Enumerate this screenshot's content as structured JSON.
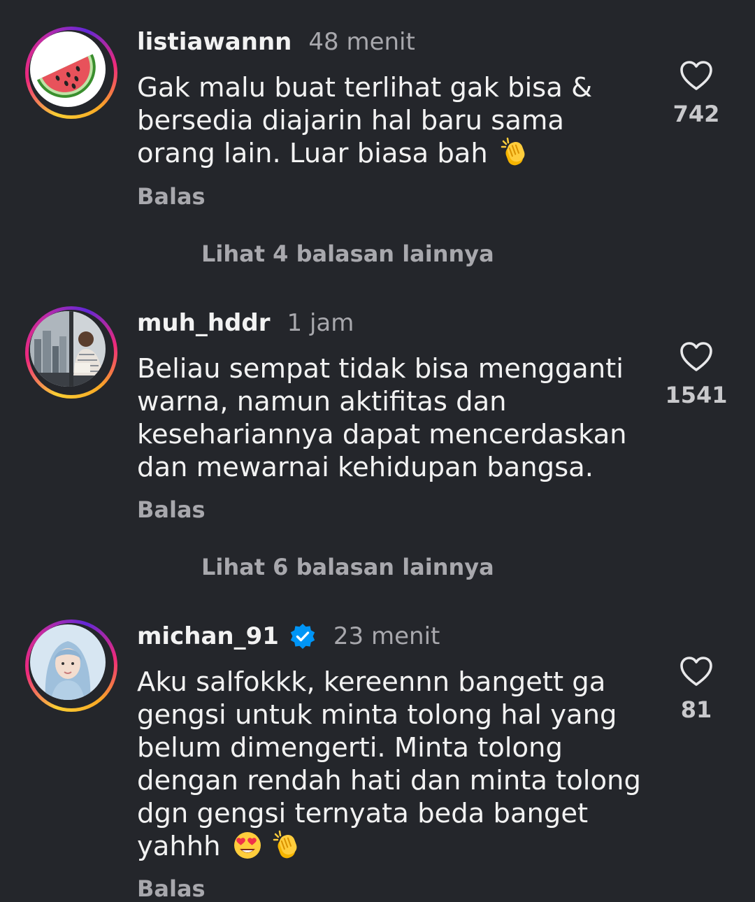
{
  "comments": [
    {
      "username": "listiawannn",
      "time": "48 menit",
      "lines": [
        "Gak malu buat terlihat gak bisa &",
        "bersedia diajarin hal baru sama",
        "orang lain. Luar biasa bah"
      ],
      "likes": "742",
      "reply_label": "Balas",
      "more_replies": "Lihat 4 balasan lainnya"
    },
    {
      "username": "muh_hddr",
      "time": "1 jam",
      "lines": [
        "Beliau sempat tidak bisa mengganti",
        "warna, namun aktifitas dan",
        "kesehariannya dapat mencerdaskan",
        "dan mewarnai kehidupan bangsa."
      ],
      "likes": "1541",
      "reply_label": "Balas",
      "more_replies": "Lihat 6 balasan lainnya"
    },
    {
      "username": "michan_91",
      "time": "23 menit",
      "verified": true,
      "lines": [
        "Aku salfokkk, kereennn bangett ga",
        "gengsi untuk minta tolong hal yang",
        "belum dimengerti. Minta tolong",
        "dengan rendah hati dan minta tolong",
        "dgn gengsi ternyata beda banget",
        "yahhh"
      ],
      "likes": "81",
      "reply_label": "Balas"
    }
  ],
  "icons": {
    "like": "heart-outline-icon",
    "verified": "verified-badge-icon",
    "clap": "clapping-hands-emoji",
    "heart_eyes": "heart-eyes-emoji"
  },
  "colors": {
    "background": "#24262b",
    "text": "#f2f2f2",
    "secondary_text": "#a8a8ad",
    "verified_blue": "#0095f6"
  }
}
